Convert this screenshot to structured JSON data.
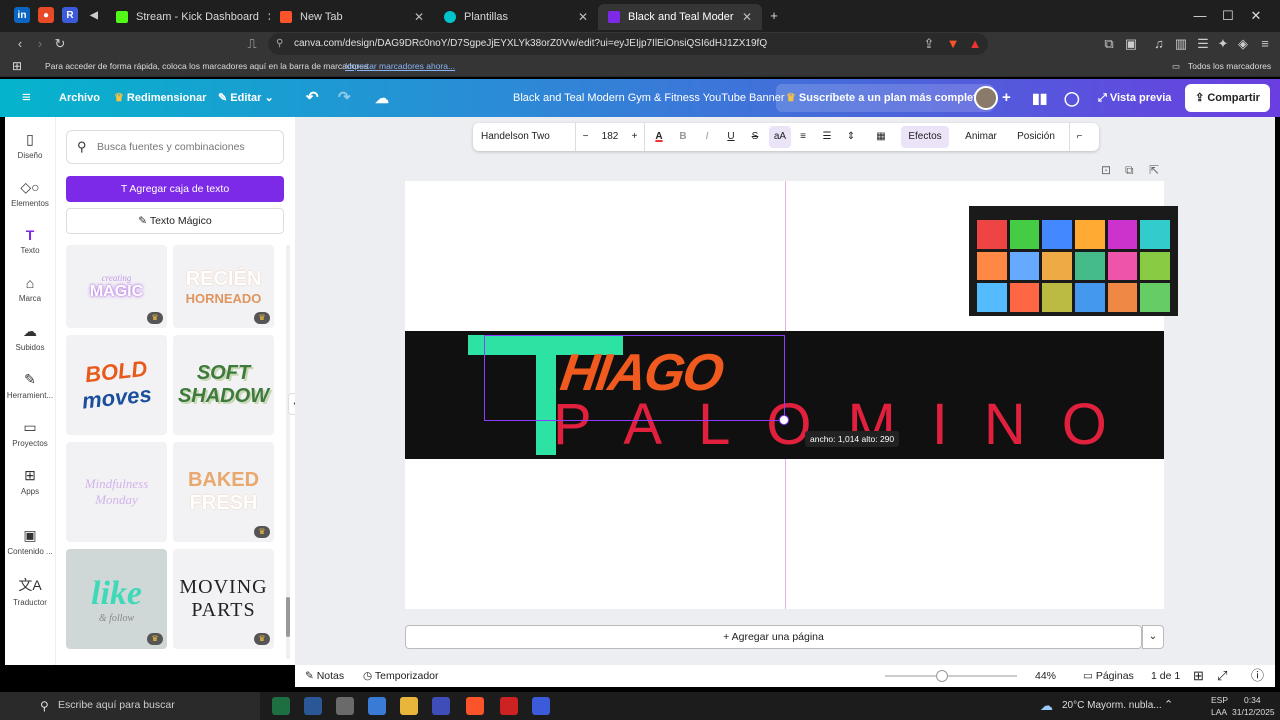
{
  "browser": {
    "tabs": [
      {
        "title": "Stream - Kick Dashboard",
        "color": "#53fc18"
      },
      {
        "title": "New Tab",
        "color": "#fb542b"
      },
      {
        "title": "Plantillas",
        "color": "#00c4cc"
      },
      {
        "title": "Black and Teal Modern Gym & Fi",
        "color": "#7d2ae8"
      }
    ],
    "new_tab": "+",
    "url": "canva.com/design/DAG9DRc0noY/D7SgpeJjEYXLYk38orZ0Vw/edit?ui=eyJEIjp7IlEiOnsiQSI6dHJ1ZX19fQ",
    "bookmarks_hint": "Para acceder de forma rápida, coloca los marcadores aquí en la barra de marcadores",
    "bookmarks_import": "Importar marcadores ahora...",
    "all_bookmarks": "Todos los marcadores"
  },
  "canva_header": {
    "file": "Archivo",
    "resize": "Redimensionar",
    "edit": "Editar",
    "title": "Black and Teal Modern Gym & Fitness YouTube Banner",
    "subscribe": "Suscríbete a un plan más completo",
    "preview": "Vista previa",
    "share": "Compartir"
  },
  "rail": [
    {
      "label": "Diseño",
      "icon": "layout-icon"
    },
    {
      "label": "Elementos",
      "icon": "shapes-icon"
    },
    {
      "label": "Texto",
      "icon": "text-icon"
    },
    {
      "label": "Marca",
      "icon": "brand-icon"
    },
    {
      "label": "Subidos",
      "icon": "upload-icon"
    },
    {
      "label": "Herramient...",
      "icon": "tools-icon"
    },
    {
      "label": "Proyectos",
      "icon": "folder-icon"
    },
    {
      "label": "Apps",
      "icon": "apps-icon"
    },
    {
      "label": "Contenido ...",
      "icon": "content-icon"
    },
    {
      "label": "Traductor",
      "icon": "translate-icon"
    }
  ],
  "panel": {
    "search_placeholder": "Busca fuentes y combinaciones",
    "add_text": "Agregar caja de texto",
    "magic_text": "Texto Mágico",
    "tiles": [
      {
        "line1": "creating",
        "line2": "MAGIC"
      },
      {
        "line1": "RECIÉN",
        "line2": "HORNEADO"
      },
      {
        "line1": "BOLD",
        "line2": "moves"
      },
      {
        "line1": "SOFT",
        "line2": "SHADOW"
      },
      {
        "line1": "Mindfulness",
        "line2": "Monday"
      },
      {
        "line1": "BAKED",
        "line2": "FRESH"
      },
      {
        "line1": "like",
        "line2": "& follow"
      },
      {
        "line1": "MOVING",
        "line2": "PARTS"
      }
    ]
  },
  "toolbar": {
    "font": "Handelson Two",
    "minus": "−",
    "size": "182",
    "plus": "+",
    "effects": "Efectos",
    "animate": "Animar",
    "position": "Posición"
  },
  "canvas": {
    "letter_t": "T",
    "line1": "HIAGO",
    "line2": "PALOMINO",
    "dimension_tip": "ancho: 1,014 alto: 290",
    "add_page": "+ Agregar una página"
  },
  "footer": {
    "notes": "Notas",
    "timer": "Temporizador",
    "zoom": "44%",
    "zoom_level": 0.44,
    "pages": "Páginas",
    "page_count": "1 de 1"
  },
  "taskbar": {
    "search_placeholder": "Escribe aquí para buscar",
    "weather": "20°C  Mayorm. nubla...",
    "lang1": "ESP",
    "lang2": "LAA",
    "time": "0:34",
    "date": "31/12/2025"
  }
}
